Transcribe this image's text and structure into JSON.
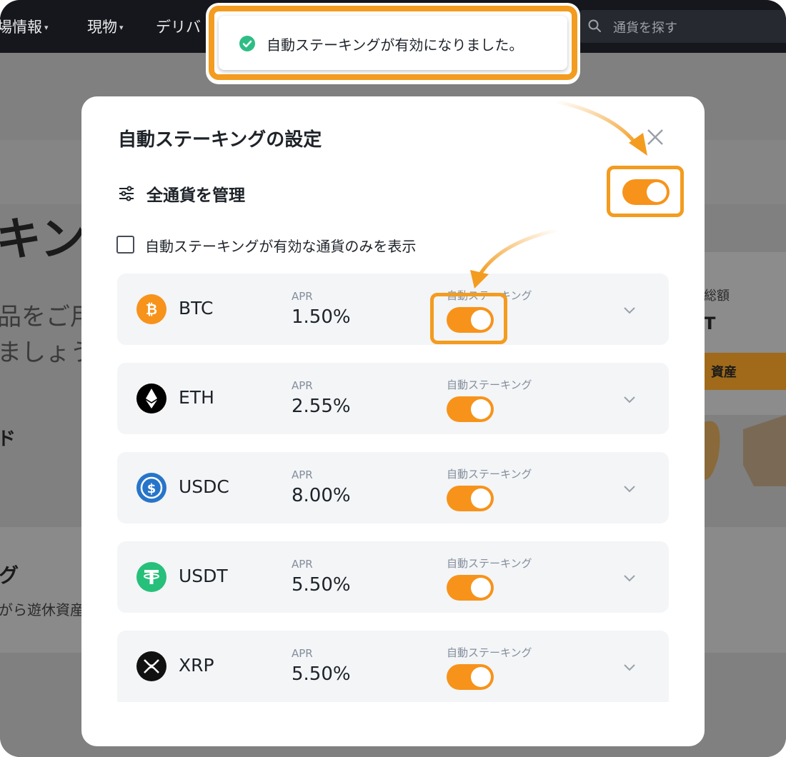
{
  "nav": {
    "items": [
      {
        "label": "場情報",
        "caret": "▾"
      },
      {
        "label": "現物",
        "caret": "▾"
      },
      {
        "label": "デリバ"
      }
    ],
    "search_placeholder": "通貨を探す"
  },
  "background": {
    "heading_fragment": "キング",
    "desc_line1": "品をご用",
    "desc_line2": "ましょう",
    "side_char": "ド",
    "section_title": "グ",
    "section_sub": "がら遊休資産",
    "card_label": "総額",
    "card_value": "T",
    "card_button": "資産"
  },
  "toast": {
    "message": "自動ステーキングが有効になりました。",
    "status_color": "#2ebd85"
  },
  "modal": {
    "title": "自動ステーキングの設定",
    "manage_all_label": "全通貨を管理",
    "manage_all_enabled": true,
    "filter_label": "自動ステーキングが有効な通貨のみを表示",
    "filter_checked": false,
    "coins": [
      {
        "symbol": "BTC",
        "icon": "bitcoin-icon",
        "apr_label": "APR",
        "apr": "1.50%",
        "auto_label": "自動ステーキング",
        "enabled": true
      },
      {
        "symbol": "ETH",
        "icon": "ethereum-icon",
        "apr_label": "APR",
        "apr": "2.55%",
        "auto_label": "自動ステーキング",
        "enabled": true
      },
      {
        "symbol": "USDC",
        "icon": "usdc-icon",
        "apr_label": "APR",
        "apr": "8.00%",
        "auto_label": "自動ステーキング",
        "enabled": true
      },
      {
        "symbol": "USDT",
        "icon": "tether-icon",
        "apr_label": "APR",
        "apr": "5.50%",
        "auto_label": "自動ステーキング",
        "enabled": true
      },
      {
        "symbol": "XRP",
        "icon": "xrp-icon",
        "apr_label": "APR",
        "apr": "5.50%",
        "auto_label": "自動ステーキング",
        "enabled": true
      }
    ]
  },
  "colors": {
    "accent_orange": "#f39c1f",
    "toggle_on": "#f7931a",
    "nav_bg": "#15171c",
    "text_primary": "#1e2329",
    "text_secondary": "#848e9c"
  }
}
